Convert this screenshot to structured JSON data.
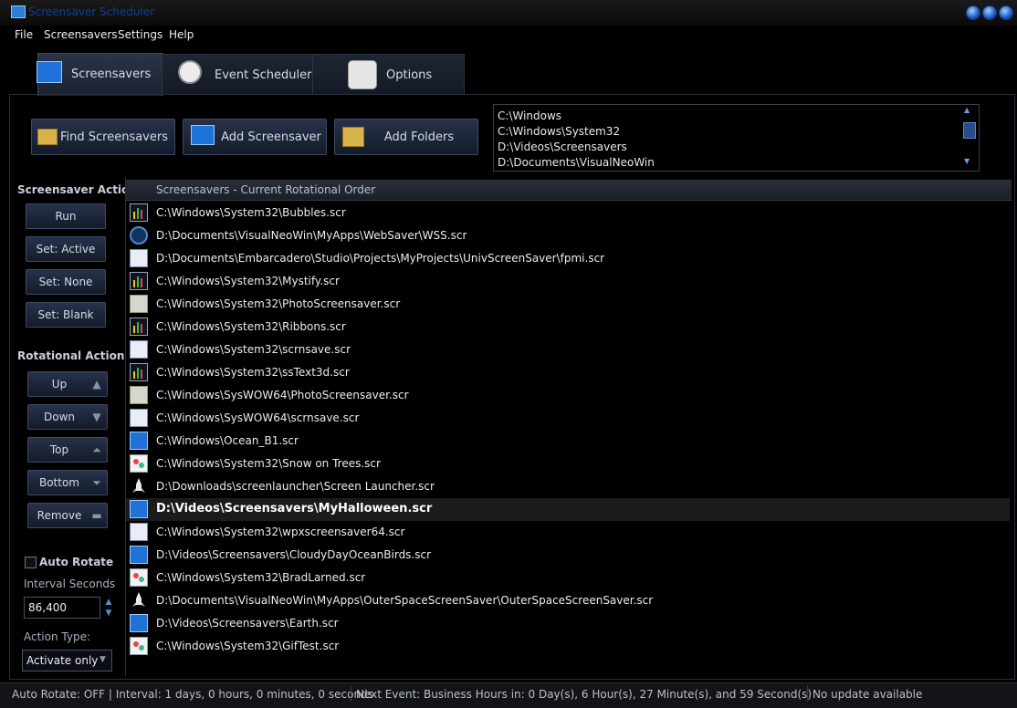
{
  "window": {
    "title": "Screensaver Scheduler"
  },
  "menu": [
    "File",
    "Screensavers",
    "Settings",
    "Help"
  ],
  "tabs": [
    {
      "label": "Screensavers",
      "icon": "monitor-icon",
      "active": true
    },
    {
      "label": "Event Scheduler",
      "icon": "clock-icon",
      "active": false
    },
    {
      "label": "Options",
      "icon": "checklist-icon",
      "active": false
    }
  ],
  "toolbar": {
    "find_label": "Find Screensavers",
    "add_label": "Add Screensaver",
    "folders_label": "Add Folders"
  },
  "folders": [
    "C:\\Windows",
    "C:\\Windows\\System32",
    "D:\\Videos\\Screensavers",
    "D:\\Documents\\VisualNeoWin"
  ],
  "screensaver_actions": {
    "title": "Screensaver Actions",
    "run": "Run",
    "set_active": "Set: Active",
    "set_none": "Set: None",
    "set_blank": "Set: Blank"
  },
  "rotational_actions": {
    "title": "Rotational Actions",
    "up": "Up",
    "down": "Down",
    "top": "Top",
    "bottom": "Bottom",
    "remove": "Remove"
  },
  "list": {
    "header": "Screensavers - Current Rotational Order",
    "items": [
      {
        "path": "C:\\Windows\\System32\\Bubbles.scr",
        "icon": "bars-icon"
      },
      {
        "path": "D:\\Documents\\VisualNeoWin\\MyApps\\WebSaver\\WSS.scr",
        "icon": "round-icon"
      },
      {
        "path": "D:\\Documents\\Embarcadero\\Studio\\Projects\\MyProjects\\UnivScreenSaver\\fpmi.scr",
        "icon": "window-icon"
      },
      {
        "path": "C:\\Windows\\System32\\Mystify.scr",
        "icon": "bars-icon"
      },
      {
        "path": "C:\\Windows\\System32\\PhotoScreensaver.scr",
        "icon": "photo-icon"
      },
      {
        "path": "C:\\Windows\\System32\\Ribbons.scr",
        "icon": "bars-icon"
      },
      {
        "path": "C:\\Windows\\System32\\scrnsave.scr",
        "icon": "window-icon"
      },
      {
        "path": "C:\\Windows\\System32\\ssText3d.scr",
        "icon": "bars-icon"
      },
      {
        "path": "C:\\Windows\\SysWOW64\\PhotoScreensaver.scr",
        "icon": "photo-icon"
      },
      {
        "path": "C:\\Windows\\SysWOW64\\scrnsave.scr",
        "icon": "window-icon"
      },
      {
        "path": "C:\\Windows\\Ocean_B1.scr",
        "icon": "monitor-icon"
      },
      {
        "path": "C:\\Windows\\System32\\Snow on Trees.scr",
        "icon": "gear-icon"
      },
      {
        "path": "D:\\Downloads\\screenlauncher\\Screen Launcher.scr",
        "icon": "rocket-icon"
      },
      {
        "path": "D:\\Videos\\Screensavers\\MyHalloween.scr",
        "icon": "monitor-icon",
        "selected": true
      },
      {
        "path": "C:\\Windows\\System32\\wpxscreensaver64.scr",
        "icon": "window-icon"
      },
      {
        "path": "D:\\Videos\\Screensavers\\CloudyDayOceanBirds.scr",
        "icon": "monitor-icon"
      },
      {
        "path": "C:\\Windows\\System32\\BradLarned.scr",
        "icon": "gear-icon"
      },
      {
        "path": "D:\\Documents\\VisualNeoWin\\MyApps\\OuterSpaceScreenSaver\\OuterSpaceScreenSaver.scr",
        "icon": "rocket-icon"
      },
      {
        "path": "D:\\Videos\\Screensavers\\Earth.scr",
        "icon": "monitor-icon"
      },
      {
        "path": "C:\\Windows\\System32\\GifTest.scr",
        "icon": "gear-icon"
      }
    ]
  },
  "rotation": {
    "auto_rotate_label": "Auto Rotate",
    "auto_rotate_checked": false,
    "interval_label": "Interval Seconds",
    "interval_value": "86,400",
    "action_type_label": "Action Type:",
    "action_type_value": "Activate only"
  },
  "status": {
    "left": "Auto Rotate: OFF | Interval: 1 days, 0 hours, 0 minutes, 0 seconds",
    "middle": "Next Event: Business Hours in: 0 Day(s), 6 Hour(s), 27 Minute(s), and 59 Second(s)",
    "right": "No update available"
  },
  "colors": {
    "accent": "#2f7fd6",
    "background": "#000000",
    "button": "#1d263a"
  }
}
